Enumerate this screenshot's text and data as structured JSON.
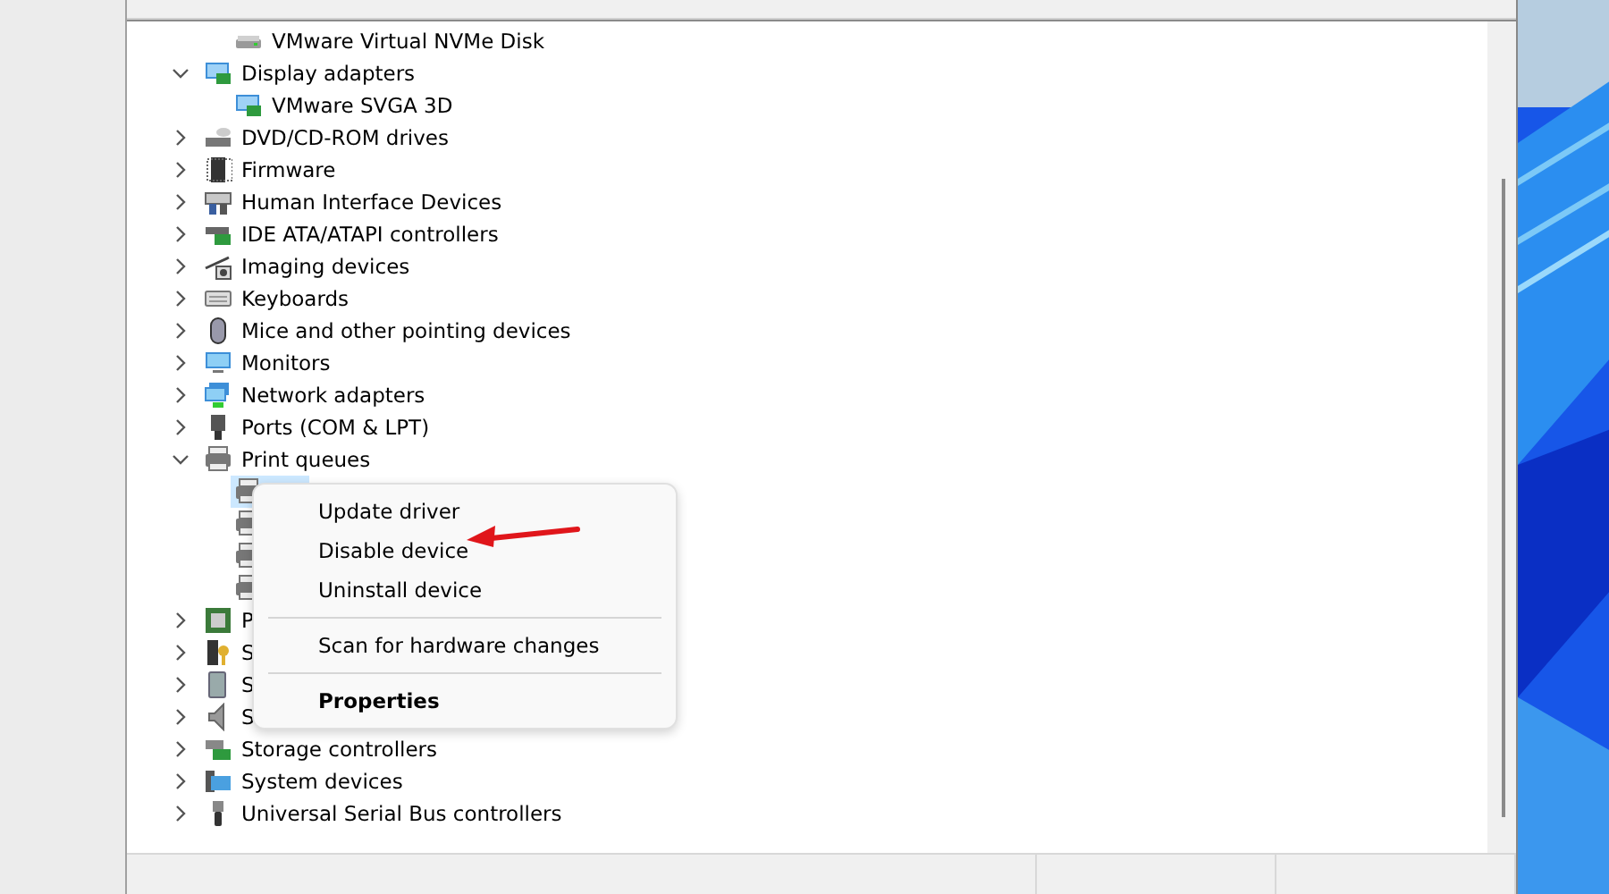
{
  "tree": {
    "items": [
      {
        "children": [
          {
            "label": "VMware Virtual NVMe Disk",
            "selected": false
          }
        ]
      },
      {
        "label": "Display adapters",
        "expanded": true,
        "children": [
          {
            "label": "VMware SVGA 3D",
            "selected": false
          }
        ]
      },
      {
        "label": "DVD/CD-ROM drives",
        "expanded": false
      },
      {
        "label": "Firmware",
        "expanded": false
      },
      {
        "label": "Human Interface Devices",
        "expanded": false
      },
      {
        "label": "IDE ATA/ATAPI controllers",
        "expanded": false
      },
      {
        "label": "Imaging devices",
        "expanded": false
      },
      {
        "label": "Keyboards",
        "expanded": false
      },
      {
        "label": "Mice and other pointing devices",
        "expanded": false
      },
      {
        "label": "Monitors",
        "expanded": false
      },
      {
        "label": "Network adapters",
        "expanded": false
      },
      {
        "label": "Ports (COM & LPT)",
        "expanded": false
      },
      {
        "label": "Print queues",
        "expanded": true,
        "children": [
          {
            "selected": true
          },
          {
            "selected": false
          },
          {
            "selected": false
          },
          {
            "selected": false
          }
        ]
      },
      {
        "label": "P",
        "expanded": false
      },
      {
        "label": "S",
        "expanded": false
      },
      {
        "label": "S",
        "expanded": false
      },
      {
        "label": "S",
        "expanded": false
      },
      {
        "label": "Storage controllers",
        "expanded": false
      },
      {
        "label": "System devices",
        "expanded": false
      },
      {
        "label": "Universal Serial Bus controllers",
        "expanded": false
      }
    ]
  },
  "context_menu": {
    "items": [
      {
        "kind": "item",
        "label": "Update driver"
      },
      {
        "kind": "item",
        "label": "Disable device"
      },
      {
        "kind": "item",
        "label": "Uninstall device"
      },
      {
        "kind": "separator"
      },
      {
        "kind": "item",
        "label": "Scan for hardware changes"
      },
      {
        "kind": "separator"
      },
      {
        "kind": "default",
        "label": "Properties"
      }
    ]
  }
}
